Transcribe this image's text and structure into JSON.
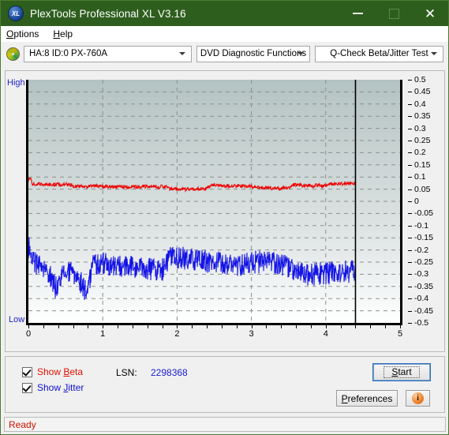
{
  "window": {
    "title": "PlexTools Professional XL V3.16",
    "app_icon": "xl-logo-icon",
    "icon_text": "XL",
    "minimize": "minimize-icon",
    "maximize": "maximize-icon",
    "close": "close-icon",
    "titlebar_color": "#2e5e1e"
  },
  "menu": {
    "items": [
      {
        "label": "Options",
        "accel": "O"
      },
      {
        "label": "Help",
        "accel": "H"
      }
    ]
  },
  "toolbar": {
    "disc_icon": "optical-disc-icon",
    "drive_select": {
      "value": "HA:8 ID:0  PX-760A",
      "options": [
        "HA:8 ID:0  PX-760A"
      ]
    },
    "function_select": {
      "value": "DVD Diagnostic Functions",
      "options": [
        "DVD Diagnostic Functions"
      ]
    },
    "test_select": {
      "value": "Q-Check Beta/Jitter Test",
      "options": [
        "Q-Check Beta/Jitter Test"
      ]
    }
  },
  "chart_panel": {
    "high_label": "High",
    "low_label": "Low"
  },
  "controls": {
    "show_beta": {
      "label": "Show Beta",
      "accel": "B",
      "checked": true,
      "color": "#e01000"
    },
    "show_jitter": {
      "label": "Show Jitter",
      "accel": "J",
      "checked": true,
      "color": "#1010d0"
    },
    "lsn_label": "LSN:",
    "lsn_value": "2298368",
    "start_button": {
      "label": "Start",
      "accel": "S"
    },
    "preferences_button": {
      "label": "Preferences",
      "accel": "P"
    },
    "info_button": {
      "icon": "info-icon",
      "glyph": "i"
    }
  },
  "statusbar": {
    "text": "Ready",
    "color": "#d01000"
  },
  "chart_data": {
    "type": "line",
    "title": "Q-Check Beta/Jitter Test",
    "xlabel": "",
    "ylabel": "",
    "xlim": [
      0,
      5
    ],
    "ylim": [
      -0.5,
      0.5
    ],
    "grid": true,
    "legend_position": "bottom-left",
    "x_ticks": [
      "0",
      "1",
      "2",
      "3",
      "4",
      "5"
    ],
    "x_tick_values": [
      0,
      1,
      2,
      3,
      4,
      5
    ],
    "y_ticks": [
      "0.5",
      "0.45",
      "0.4",
      "0.35",
      "0.3",
      "0.25",
      "0.2",
      "0.15",
      "0.1",
      "0.05",
      "0",
      "-0.05",
      "-0.1",
      "-0.15",
      "-0.2",
      "-0.25",
      "-0.3",
      "-0.35",
      "-0.4",
      "-0.45",
      "-0.5"
    ],
    "y_tick_values": [
      0.5,
      0.45,
      0.4,
      0.35,
      0.3,
      0.25,
      0.2,
      0.15,
      0.1,
      0.05,
      0,
      -0.05,
      -0.1,
      -0.15,
      -0.2,
      -0.25,
      -0.3,
      -0.35,
      -0.4,
      -0.45,
      -0.5
    ],
    "axis_side_labels": {
      "top_left": "High",
      "bottom_left": "Low"
    },
    "cursor_line": {
      "x": 4.4,
      "color": "#000000"
    },
    "data_end_x": 4.4,
    "series": [
      {
        "name": "Beta",
        "color": "#ee0000",
        "x": [
          0.0,
          0.04,
          0.05,
          0.08,
          0.12,
          0.2,
          0.3,
          0.4,
          0.5,
          0.58,
          0.6,
          0.7,
          0.8,
          0.9,
          1.0,
          1.05,
          1.1,
          1.2,
          1.3,
          1.4,
          1.5,
          1.6,
          1.7,
          1.8,
          1.86,
          1.9,
          2.0,
          2.1,
          2.2,
          2.3,
          2.4,
          2.46,
          2.5,
          2.6,
          2.7,
          2.8,
          2.9,
          3.0,
          3.05,
          3.1,
          3.2,
          3.3,
          3.4,
          3.5,
          3.55,
          3.6,
          3.7,
          3.8,
          3.9,
          4.0,
          4.05,
          4.1,
          4.2,
          4.3,
          4.4
        ],
        "y": [
          0.09,
          0.092,
          0.072,
          0.071,
          0.07,
          0.07,
          0.069,
          0.069,
          0.068,
          0.068,
          0.062,
          0.062,
          0.062,
          0.062,
          0.061,
          0.061,
          0.06,
          0.06,
          0.06,
          0.059,
          0.061,
          0.061,
          0.06,
          0.06,
          0.06,
          0.05,
          0.05,
          0.05,
          0.051,
          0.051,
          0.052,
          0.066,
          0.066,
          0.065,
          0.064,
          0.063,
          0.062,
          0.061,
          0.061,
          0.057,
          0.055,
          0.055,
          0.054,
          0.054,
          0.068,
          0.068,
          0.066,
          0.065,
          0.065,
          0.066,
          0.072,
          0.072,
          0.073,
          0.074,
          0.074
        ],
        "noise": 0.008
      },
      {
        "name": "Jitter",
        "color": "#1414e6",
        "x": [
          0.0,
          0.02,
          0.05,
          0.1,
          0.16,
          0.22,
          0.28,
          0.33,
          0.36,
          0.4,
          0.44,
          0.5,
          0.56,
          0.6,
          0.66,
          0.7,
          0.74,
          0.78,
          0.82,
          0.86,
          0.9,
          1.0,
          1.1,
          1.2,
          1.3,
          1.4,
          1.5,
          1.6,
          1.7,
          1.8,
          1.84,
          1.88,
          1.94,
          2.0,
          2.1,
          2.2,
          2.3,
          2.4,
          2.5,
          2.6,
          2.7,
          2.8,
          2.9,
          3.0,
          3.1,
          3.2,
          3.3,
          3.4,
          3.45,
          3.5,
          3.55,
          3.6,
          3.65,
          3.7,
          3.8,
          3.9,
          4.0,
          4.1,
          4.2,
          4.3,
          4.4
        ],
        "y": [
          -0.195,
          -0.195,
          -0.225,
          -0.255,
          -0.275,
          -0.285,
          -0.3,
          -0.33,
          -0.355,
          -0.33,
          -0.305,
          -0.295,
          -0.295,
          -0.3,
          -0.31,
          -0.33,
          -0.35,
          -0.375,
          -0.33,
          -0.255,
          -0.255,
          -0.255,
          -0.262,
          -0.268,
          -0.27,
          -0.272,
          -0.274,
          -0.276,
          -0.278,
          -0.28,
          -0.268,
          -0.238,
          -0.232,
          -0.232,
          -0.236,
          -0.24,
          -0.244,
          -0.248,
          -0.252,
          -0.255,
          -0.258,
          -0.26,
          -0.262,
          -0.25,
          -0.25,
          -0.252,
          -0.255,
          -0.258,
          -0.262,
          -0.27,
          -0.282,
          -0.292,
          -0.298,
          -0.3,
          -0.3,
          -0.298,
          -0.296,
          -0.294,
          -0.292,
          -0.29,
          -0.29
        ],
        "noise": 0.048
      }
    ]
  }
}
